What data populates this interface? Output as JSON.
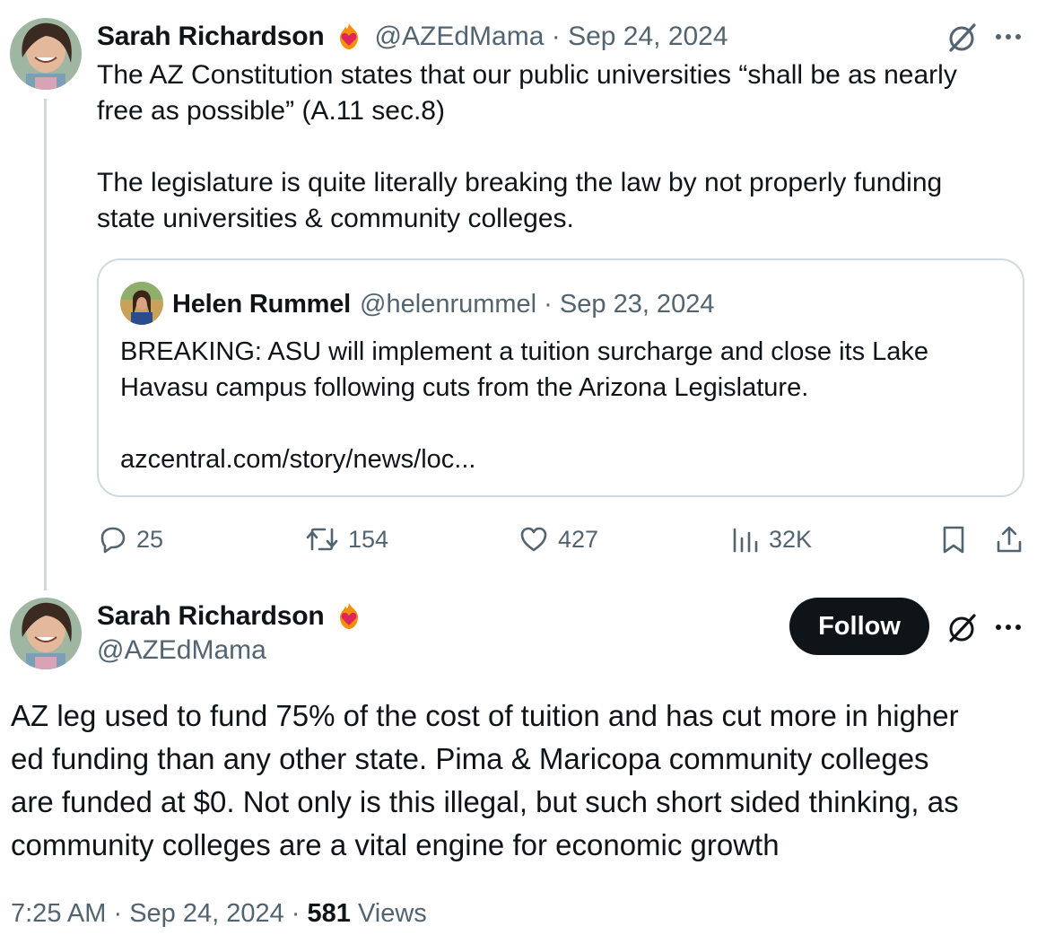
{
  "tweet1": {
    "author": "Sarah Richardson",
    "handle": "@AZEdMama",
    "date": "Sep 24, 2024",
    "separator": " · ",
    "body_lines": [
      "The AZ Constitution states that our public universities “shall be as nearly",
      "free as possible” (A.11 sec.8)",
      "",
      "The legislature is quite literally breaking the law by not properly funding",
      "state universities & community colleges."
    ],
    "more_icon_text": "···"
  },
  "quote": {
    "author": "Helen Rummel",
    "handle": "@helenrummel",
    "date": "Sep 23, 2024",
    "separator": " · ",
    "body_lines": [
      "BREAKING: ASU will implement a tuition surcharge and close its Lake",
      "Havasu campus following cuts from the Arizona Legislature."
    ],
    "link": "azcentral.com/story/news/loc..."
  },
  "actions": {
    "replies": "25",
    "reposts": "154",
    "likes": "427",
    "views": "32K"
  },
  "tweet2": {
    "author": "Sarah Richardson",
    "handle": "@AZEdMama",
    "follow_label": "Follow",
    "more_icon_text": "···",
    "body_lines": [
      "AZ leg used to fund 75% of the cost of tuition and has cut more in higher",
      "ed funding than any other state. Pima & Maricopa community colleges",
      "are funded at $0. Not only is this illegal, but such short sided thinking, as",
      "community colleges are a vital engine for economic growth"
    ],
    "time": "7:25 AM",
    "date": "Sep 24, 2024",
    "separator": " · ",
    "views_count": "581",
    "views_label": " Views"
  },
  "icons": {
    "badge": "heart-fire-emoji-badge",
    "grok": "grok-icon",
    "more": "more-icon",
    "reply": "reply-icon",
    "repost": "repost-icon",
    "like": "like-icon",
    "views": "views-icon",
    "bookmark": "bookmark-icon",
    "share": "share-icon"
  },
  "colors": {
    "text": "#0f1419",
    "secondary": "#536471",
    "border": "#cfd9de",
    "follow_bg": "#0f1419",
    "badge_red": "#e0245e",
    "badge_orange": "#f4900c"
  }
}
